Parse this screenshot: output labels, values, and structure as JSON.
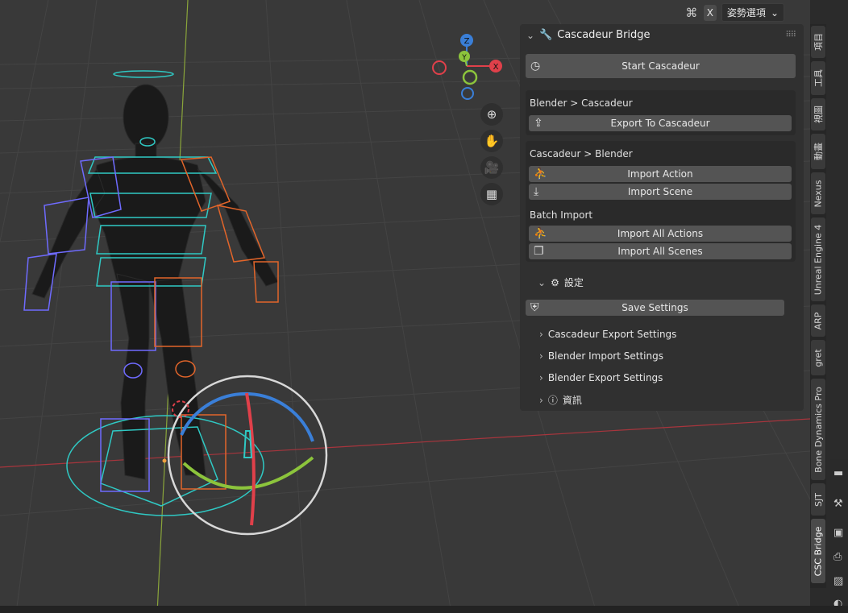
{
  "header": {
    "x_label": "X",
    "mode_label": "姿勢選項",
    "dropdown_icon": "chevron-down-icon"
  },
  "gizmo": {
    "z": "Z",
    "y": "Y",
    "x": "X"
  },
  "panel": {
    "title": "Cascadeur Bridge",
    "start_button": "Start Cascadeur",
    "section_blender_to_csc": "Blender > Cascadeur",
    "export_button": "Export To Cascadeur",
    "section_csc_to_blender": "Cascadeur > Blender",
    "import_action_button": "Import Action",
    "import_scene_button": "Import Scene",
    "section_batch": "Batch Import",
    "import_all_actions_button": "Import All Actions",
    "import_all_scenes_button": "Import All Scenes",
    "settings_label": "設定",
    "save_settings_button": "Save Settings",
    "sub_cascadeur_export": "Cascadeur Export Settings",
    "sub_blender_import": "Blender Import Settings",
    "sub_blender_export": "Blender Export Settings",
    "info_label": "資訊"
  },
  "tabs": [
    "項目",
    "工具",
    "視圖",
    "動畫",
    "Nexus",
    "Unreal Engine 4",
    "ARP",
    "gret",
    "Bone Dynamics Pro",
    "SJT",
    "CSC Bridge"
  ],
  "colors": {
    "viewport_bg": "#393939",
    "panel_bg": "#303030",
    "button_bg": "#545454",
    "axis_x": "#e0404a",
    "axis_y": "#8cc43c",
    "axis_z": "#3a7fd8",
    "rig_left": "#6f6bff",
    "rig_right": "#e2652a",
    "rig_center": "#2fc9c4"
  }
}
